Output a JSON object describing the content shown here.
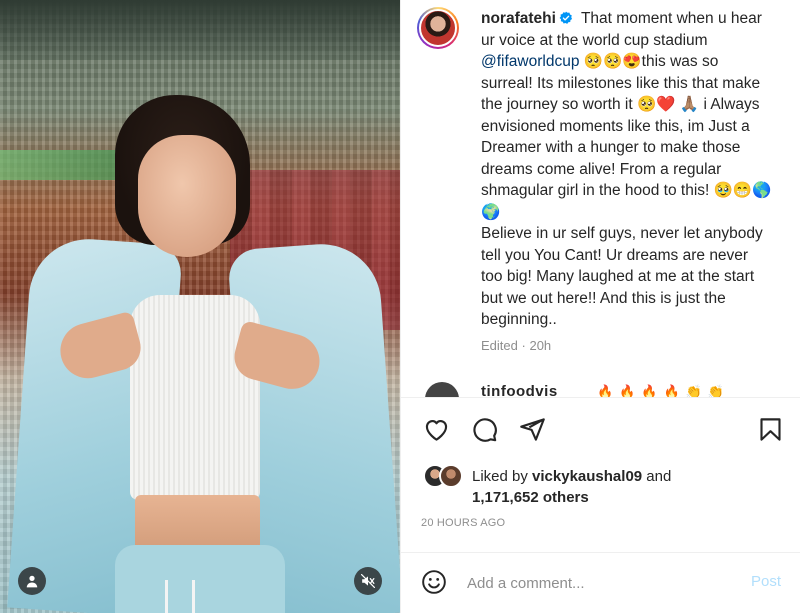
{
  "media": {
    "tag_icon": "person-icon",
    "mute_icon": "speaker-muted-icon"
  },
  "post": {
    "author": "norafatehi",
    "verified_icon": "verified-badge-icon",
    "caption_segments": [
      " That moment when u hear ur voice at the world cup stadium ",
      "@fifaworldcup",
      " 🥺🥺😍this was so surreal! Its milestones like this that make the journey so worth it 🥺❤️ 🙏🏽 i Always envisioned moments like this, im Just a Dreamer with a hunger to make those dreams come alive! From a regular shmagular girl in the hood to this! 🥹😁🌎🌍",
      "Believe in ur self guys, never let anybody tell you You Cant! Ur dreams are never too big! Many laughed at me at the start but we out here!! And this is just the beginning.."
    ],
    "edited_label": "Edited",
    "separator": "·",
    "age": "20h",
    "next_comment_user": "tinfoodvis",
    "next_comment_emoji": "🔥🔥🔥🔥👏👏"
  },
  "actions": {
    "like_icon": "heart-icon",
    "comment_icon": "comment-icon",
    "share_icon": "paper-plane-icon",
    "save_icon": "bookmark-icon"
  },
  "likes": {
    "prefix": "Liked by ",
    "user": "vickykaushal09",
    "middle": " and",
    "count": "1,171,652 others"
  },
  "timestamp": "20 HOURS AGO",
  "comment_box": {
    "emoji_icon": "smiley-icon",
    "placeholder": "Add a comment...",
    "post_label": "Post"
  },
  "colors": {
    "link": "#00376b",
    "post_disabled": "#b2dffc",
    "muted": "#8e8e8e",
    "verified": "#0095f6"
  }
}
